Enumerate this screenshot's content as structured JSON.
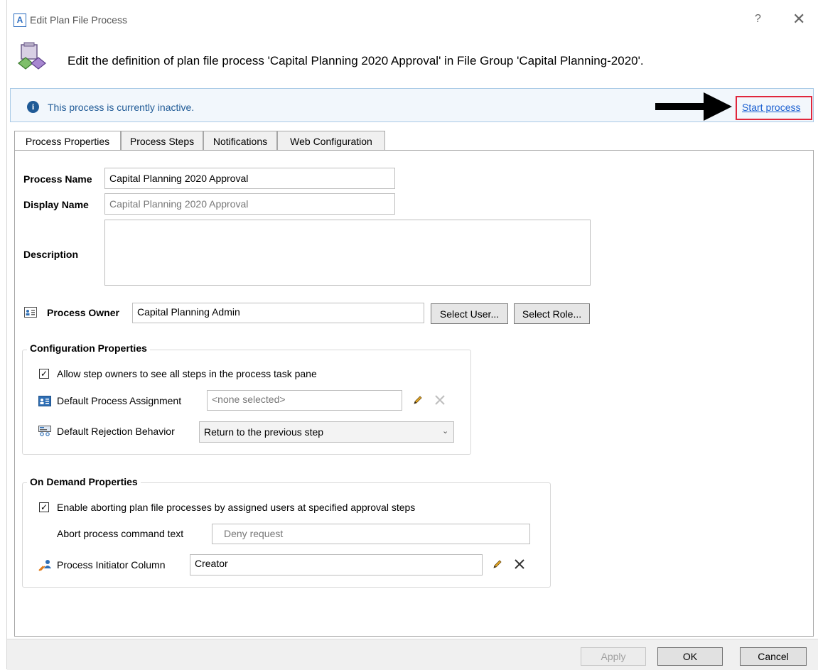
{
  "window": {
    "title": "Edit Plan File Process",
    "app_icon_letter": "A",
    "help_glyph": "?",
    "close_glyph": "✕"
  },
  "header": {
    "text": "Edit the definition of plan file process 'Capital Planning 2020 Approval' in File Group 'Capital Planning-2020'."
  },
  "info_bar": {
    "icon_glyph": "i",
    "message": "This process is currently inactive.",
    "link": "Start process"
  },
  "tabs": [
    {
      "label": "Process Properties"
    },
    {
      "label": "Process Steps"
    },
    {
      "label": "Notifications"
    },
    {
      "label": "Web Configuration"
    }
  ],
  "form": {
    "process_name_label": "Process Name",
    "process_name_value": "Capital Planning 2020 Approval",
    "display_name_label": "Display Name",
    "display_name_placeholder": "Capital Planning 2020 Approval",
    "description_label": "Description",
    "description_value": "",
    "owner_label": "Process Owner",
    "owner_value": "Capital Planning Admin",
    "select_user_label": "Select User...",
    "select_role_label": "Select Role..."
  },
  "config": {
    "title": "Configuration Properties",
    "allow_see_steps_label": "Allow step owners to see all steps in the process task pane",
    "allow_see_steps_checked": true,
    "default_assignment_label": "Default Process Assignment",
    "default_assignment_value": "<none selected>",
    "default_rejection_label": "Default Rejection Behavior",
    "default_rejection_value": "Return to the previous step"
  },
  "on_demand": {
    "title": "On Demand Properties",
    "enable_abort_label": "Enable aborting plan file processes by assigned users at specified approval steps",
    "enable_abort_checked": true,
    "abort_text_label": "Abort process command text",
    "abort_text_placeholder": "Deny request",
    "initiator_label": "Process Initiator Column",
    "initiator_value": "Creator"
  },
  "footer": {
    "apply_label": "Apply",
    "ok_label": "OK",
    "cancel_label": "Cancel"
  },
  "colors": {
    "link": "#1a5fd1",
    "highlight_box": "#e0263c",
    "info_text": "#1f5a96"
  }
}
